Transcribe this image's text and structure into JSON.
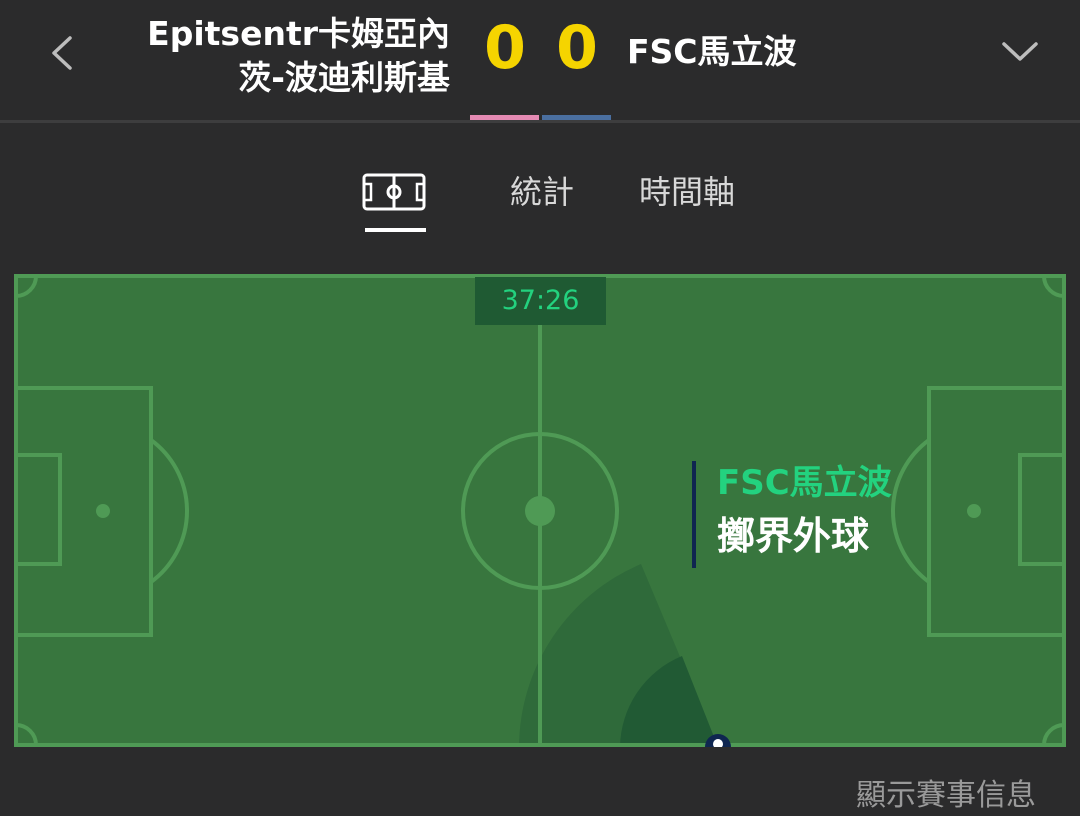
{
  "header": {
    "home_team_line1": "Epitsentr卡姆亞內",
    "home_team_line2": "茨-波迪利斯基",
    "away_team": "FSC馬立波",
    "home_score": "0",
    "away_score": "0",
    "back_icon": "chevron-left-icon",
    "expand_icon": "chevron-down-icon"
  },
  "tabs": [
    {
      "label": "",
      "icon": "pitch-icon",
      "active": true
    },
    {
      "label": "統計",
      "active": false
    },
    {
      "label": "時間軸",
      "active": false
    }
  ],
  "pitch": {
    "clock": "37:26",
    "event_team": "FSC馬立波",
    "event_type": "擲界外球"
  },
  "footer": {
    "show_info_label": "顯示賽事信息"
  },
  "colors": {
    "background": "#2b2b2c",
    "score": "#f5d400",
    "home_bar": "#e48ab3",
    "away_bar": "#4a6fa0",
    "pitch_green": "#38763e",
    "event_team": "#23d27f",
    "event_marker": "#0f2650"
  }
}
